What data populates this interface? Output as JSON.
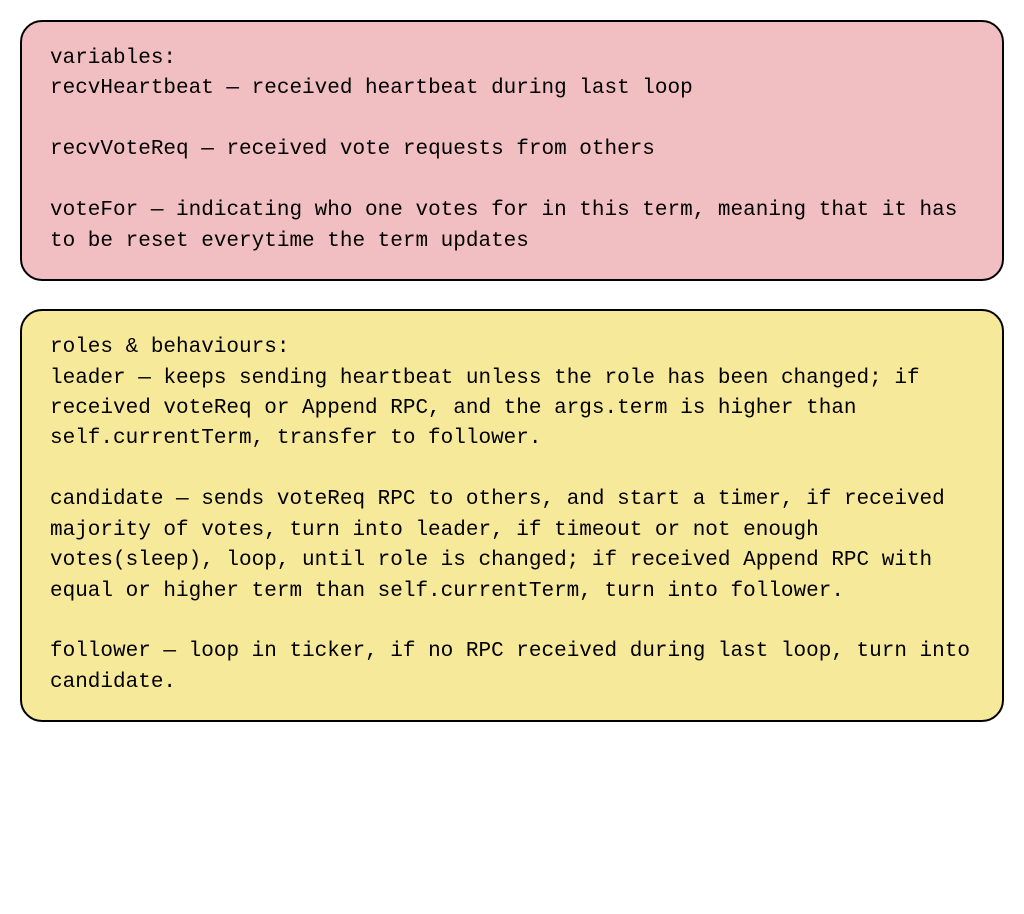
{
  "variables_box": {
    "heading": "variables:",
    "items": [
      {
        "name": "recvHeartbeat",
        "sep": " — ",
        "desc": "received heartbeat during last loop"
      },
      {
        "name": "recvVoteReq",
        "sep": " — ",
        "desc": "received vote requests from others"
      },
      {
        "name": "voteFor",
        "sep": " — ",
        "desc": "indicating who one votes for in this term, meaning that it has to be reset everytime the term updates"
      }
    ]
  },
  "roles_box": {
    "heading": "roles & behaviours:",
    "items": [
      {
        "name": "leader",
        "sep": " — ",
        "desc": "keeps sending heartbeat unless the role has been changed; if received voteReq or Append RPC, and the args.term is higher than self.currentTerm, transfer to follower."
      },
      {
        "name": "candidate",
        "sep": " — ",
        "desc": "sends voteReq RPC to others, and start a timer, if received majority of votes, turn into leader, if timeout or not enough votes(sleep), loop, until role is changed; if received Append RPC with equal or higher term than self.currentTerm, turn into follower."
      },
      {
        "name": "follower",
        "sep": " — ",
        "desc": "loop in ticker, if no RPC received during last loop, turn into candidate."
      }
    ]
  }
}
